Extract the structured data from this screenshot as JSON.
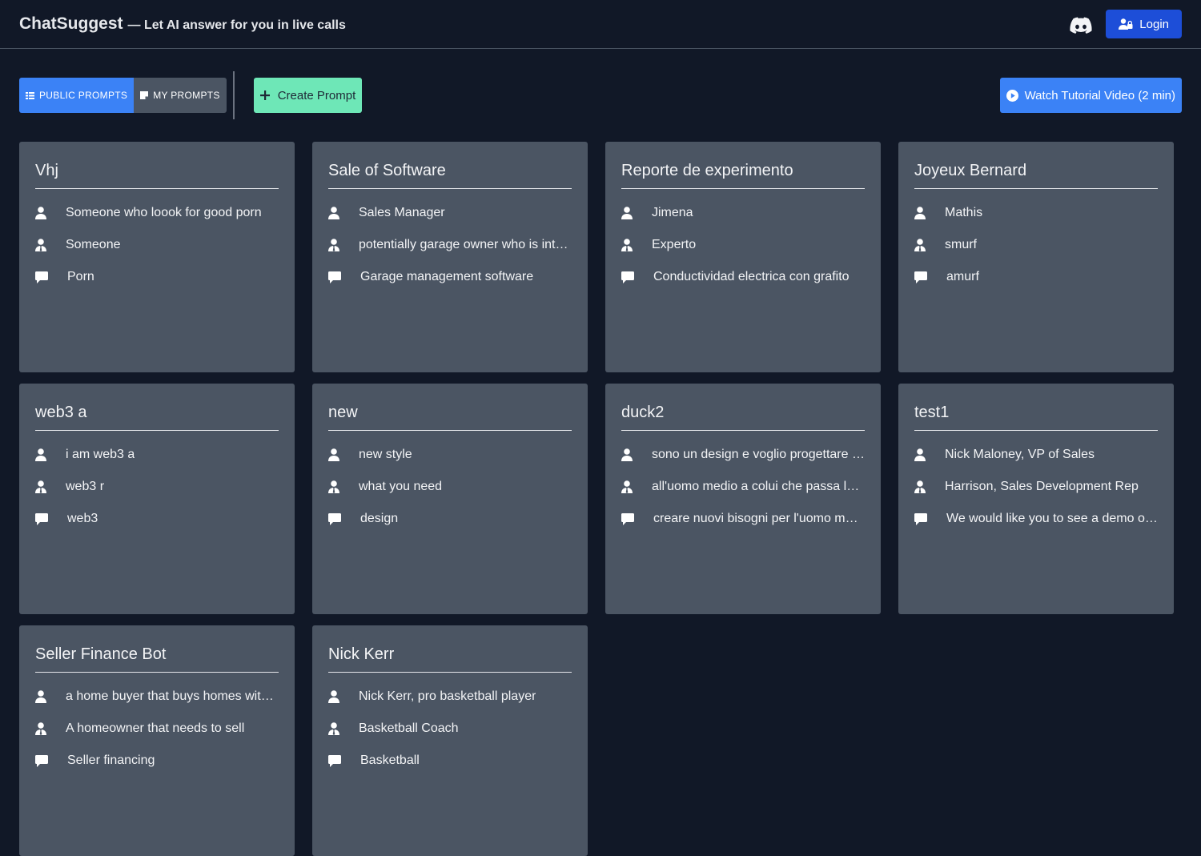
{
  "header": {
    "brand": "ChatSuggest",
    "tagline": "— Let AI answer for you in live calls",
    "discord_icon": "discord-icon",
    "login_label": "Login"
  },
  "toolbar": {
    "public_label": "PUBLIC PROMPTS",
    "mine_label": "MY PROMPTS",
    "create_label": "Create Prompt",
    "tutorial_label": "Watch Tutorial Video (2 min)"
  },
  "cards": [
    {
      "title": "Vhj",
      "you": "Someone who loook for good porn",
      "other": "Someone",
      "topic": "Porn"
    },
    {
      "title": "Sale of Software",
      "you": "Sales Manager",
      "other": "potentially garage owner who is interested",
      "topic": "Garage management software"
    },
    {
      "title": "Reporte de experimento",
      "you": "Jimena",
      "other": "Experto",
      "topic": "Conductividad electrica con grafito"
    },
    {
      "title": "Joyeux Bernard",
      "you": "Mathis",
      "other": "smurf",
      "topic": "amurf"
    },
    {
      "title": "web3 a",
      "you": "i am web3 a",
      "other": "web3 r",
      "topic": "web3"
    },
    {
      "title": "new",
      "you": "new style",
      "other": "what you need",
      "topic": "design"
    },
    {
      "title": "duck2",
      "you": "sono un design e voglio progettare un prodotto",
      "other": "all'uomo medio a colui che passa la giornata",
      "topic": "creare nuovi bisogni per l'uomo medio"
    },
    {
      "title": "test1",
      "you": "Nick Maloney, VP of Sales",
      "other": "Harrison, Sales Development Rep",
      "topic": "We would like you to see a demo of our product"
    },
    {
      "title": "Seller Finance Bot",
      "you": "a home buyer that buys homes with seller financing",
      "other": "A homeowner that needs to sell",
      "topic": "Seller financing"
    },
    {
      "title": "Nick Kerr",
      "you": "Nick Kerr, pro basketball player",
      "other": "Basketball Coach",
      "topic": "Basketball"
    }
  ]
}
